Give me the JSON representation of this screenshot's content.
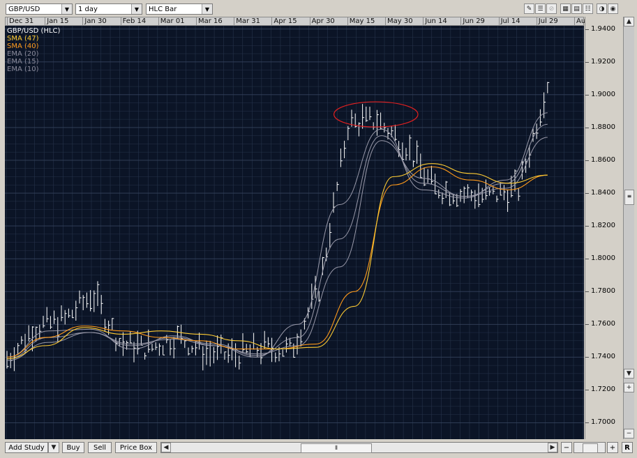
{
  "toolbar": {
    "symbol": "GBP/USD",
    "interval": "1 day",
    "chart_style": "HLC Bar"
  },
  "icons": [
    "pencil-icon",
    "horizontal-line-icon",
    "eraser-icon",
    "grid-icon",
    "table-icon",
    "list-icon",
    "crosshair-icon",
    "target-icon"
  ],
  "date_axis": [
    "Dec 31",
    "Jan 15",
    "Jan 30",
    "Feb 14",
    "Mar 01",
    "Mar 16",
    "Mar 31",
    "Apr 15",
    "Apr 30",
    "May 15",
    "May 30",
    "Jun 14",
    "Jun 29",
    "Jul 14",
    "Jul 29",
    "Aug"
  ],
  "legend": [
    {
      "label": "GBP/USD (HLC)",
      "color": "#ffffff"
    },
    {
      "label": "SMA (47)",
      "color": "#ffcc33"
    },
    {
      "label": "SMA (40)",
      "color": "#ff9a1a"
    },
    {
      "label": "EMA (20)",
      "color": "#8a8a9a"
    },
    {
      "label": "EMA (15)",
      "color": "#8a8a9a"
    },
    {
      "label": "EMA (10)",
      "color": "#8a8a9a"
    }
  ],
  "price_axis": [
    "1.9400",
    "1.9200",
    "1.9000",
    "1.8800",
    "1.8600",
    "1.8400",
    "1.8200",
    "1.8000",
    "1.7800",
    "1.7600",
    "1.7400",
    "1.7200",
    "1.7000"
  ],
  "bottom": {
    "add_study": "Add Study",
    "buy": "Buy",
    "sell": "Sell",
    "price_box": "Price Box",
    "minus": "−",
    "plus": "+",
    "right": "R"
  },
  "colors": {
    "plot_bg": "#0b1426",
    "grid": "#26334a",
    "price": "#ffffff",
    "ema": "#9a9aaa",
    "sma47": "#ffcc33",
    "sma40": "#ff9a1a",
    "annotation": "#e02020"
  },
  "chart_data": {
    "type": "line",
    "series_kind": "hlc-bars",
    "ylim": [
      1.69,
      1.942
    ],
    "x": [
      "Dec 31",
      "Jan 15",
      "Jan 30",
      "Feb 14",
      "Mar 01",
      "Mar 16",
      "Mar 31",
      "Apr 15",
      "Apr 30",
      "May 15",
      "May 30",
      "Jun 14",
      "Jun 29",
      "Jul 14",
      "Jul 29",
      "Aug"
    ],
    "close": [
      1.738,
      1.758,
      1.762,
      1.778,
      1.748,
      1.745,
      1.752,
      1.742,
      1.741,
      1.745,
      1.744,
      1.783,
      1.882,
      1.884,
      1.869,
      1.843,
      1.839,
      1.838,
      1.842,
      1.907
    ],
    "series": [
      {
        "name": "SMA (47)",
        "values": [
          1.739,
          1.747,
          1.758,
          1.754,
          1.756,
          1.754,
          1.75,
          1.745,
          1.746,
          1.771,
          1.85,
          1.858,
          1.852,
          1.846,
          1.851
        ]
      },
      {
        "name": "SMA (40)",
        "values": [
          1.74,
          1.752,
          1.759,
          1.756,
          1.752,
          1.75,
          1.745,
          1.745,
          1.748,
          1.78,
          1.845,
          1.856,
          1.848,
          1.842,
          1.851
        ]
      },
      {
        "name": "EMA (20)",
        "values": [
          1.738,
          1.749,
          1.755,
          1.748,
          1.751,
          1.747,
          1.742,
          1.747,
          1.795,
          1.872,
          1.849,
          1.838,
          1.843,
          1.874
        ]
      },
      {
        "name": "EMA (15)",
        "values": [
          1.739,
          1.752,
          1.755,
          1.747,
          1.752,
          1.748,
          1.741,
          1.752,
          1.812,
          1.875,
          1.846,
          1.838,
          1.846,
          1.882
        ]
      },
      {
        "name": "EMA (10)",
        "values": [
          1.74,
          1.756,
          1.757,
          1.745,
          1.753,
          1.747,
          1.74,
          1.76,
          1.833,
          1.879,
          1.842,
          1.837,
          1.848,
          1.889
        ]
      }
    ],
    "annotation": {
      "type": "ellipse",
      "x_range": [
        "May 10",
        "Jun 04"
      ],
      "y_center": 1.888
    },
    "grid": true
  }
}
